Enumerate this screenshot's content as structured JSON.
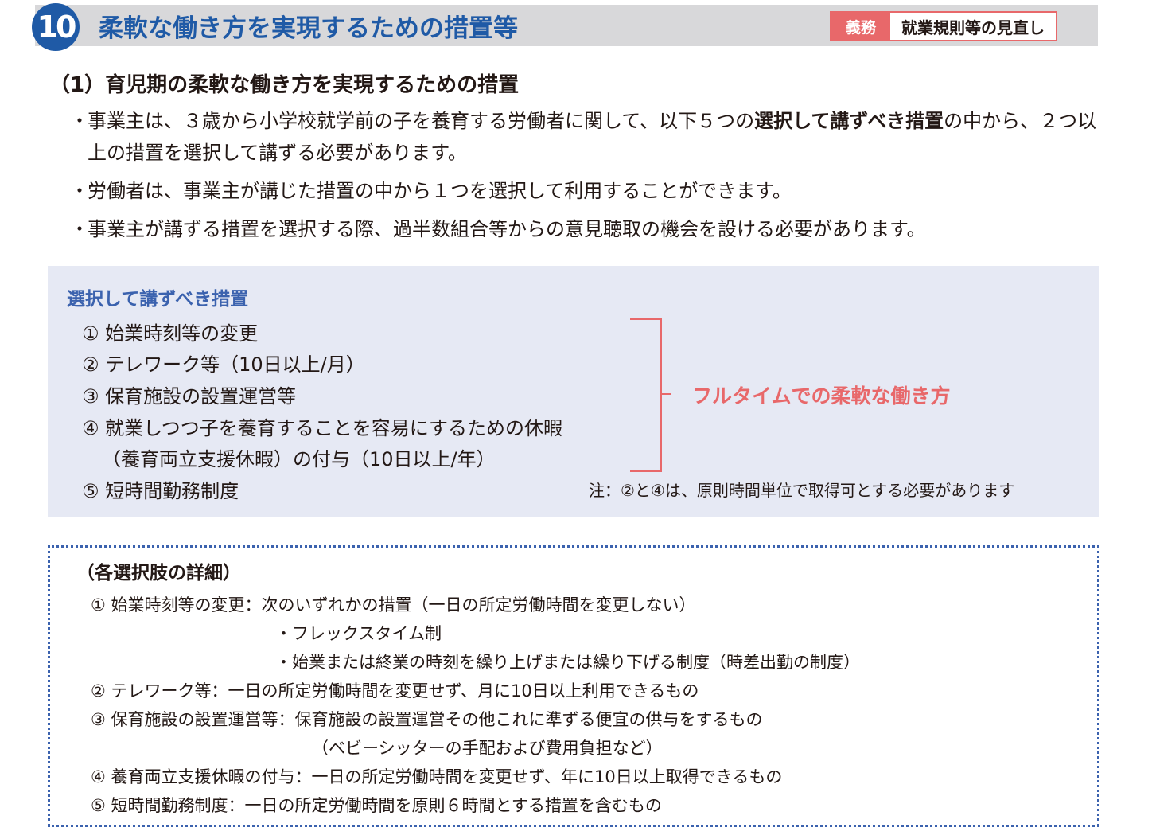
{
  "header": {
    "section_number": "10",
    "title": "柔軟な働き方を実現するための措置等",
    "tag_label": "義務",
    "tag_value": "就業規則等の見直し"
  },
  "subheading": "（1）育児期の柔軟な働き方を実現するための措置",
  "bullets": {
    "b1_pre": "事業主は、３歳から小学校就学前の子を養育する労働者に関して、以下５つの",
    "b1_bold": "選択して講ずべき措置",
    "b1_post": "の中から、２つ以上の措置を選択して講ずる必要があります。",
    "b2": "労働者は、事業主が講じた措置の中から１つを選択して利用することができます。",
    "b3": "事業主が講ずる措置を選択する際、過半数組合等からの意見聴取の機会を設ける必要があります。"
  },
  "measures": {
    "title": "選択して講ずべき措置",
    "m1": "① 始業時刻等の変更",
    "m2": "② テレワーク等（10日以上/月）",
    "m3": "③ 保育施設の設置運営等",
    "m4": "④ 就業しつつ子を養育することを容易にするための休暇",
    "m4b": "（養育両立支援休暇）の付与（10日以上/年）",
    "m5": "⑤ 短時間勤務制度",
    "fulltime_label": "フルタイムでの柔軟な働き方",
    "note": "注：②と④は、原則時間単位で取得可とする必要があります"
  },
  "details": {
    "title": "（各選択肢の詳細）",
    "d1": "① 始業時刻等の変更：次のいずれかの措置（一日の所定労働時間を変更しない）",
    "d1a": "・フレックスタイム制",
    "d1b": "・始業または終業の時刻を繰り上げまたは繰り下げる制度（時差出勤の制度）",
    "d2": "② テレワーク等：一日の所定労働時間を変更せず、月に10日以上利用できるもの",
    "d3": "③ 保育施設の設置運営等：保育施設の設置運営その他これに準ずる便宜の供与をするもの",
    "d3a": "（ベビーシッターの手配および費用負担など）",
    "d4": "④ 養育両立支援休暇の付与：一日の所定労働時間を変更せず、年に10日以上取得できるもの",
    "d5": "⑤ 短時間勤務制度：一日の所定労働時間を原則６時間とする措置を含むもの"
  },
  "colors": {
    "primary_blue": "#1f5aa6",
    "accent_red": "#e8686a",
    "box_bg": "#e6e9f4",
    "header_gray": "#d8d8da"
  }
}
